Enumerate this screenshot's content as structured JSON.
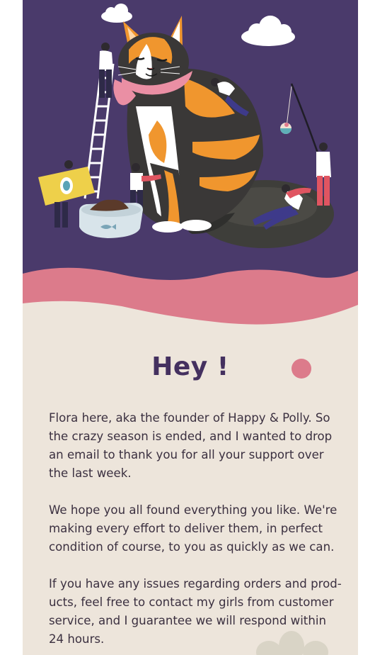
{
  "email": {
    "headline": "Hey !",
    "paragraphs": [
      "Flora here, aka the founder of Happy & Polly. So the crazy season is ended, and I wanted to drop an email to thank you for all your support over the last week.",
      "We hope you all found everything you like. We're making every effort to deliver them, in perfect condition of course, to you as quickly as we can.",
      "If you have any issues regarding orders and prod-ucts, feel free to contact my girls from customer service, and I guarantee we will respond within 24 hours."
    ]
  },
  "colors": {
    "hero_background": "#4a3a6b",
    "wave_pink": "#dc7b8b",
    "page_background": "#ede5db",
    "headline": "#44305f",
    "accent_dot": "#dc7b8b"
  },
  "illustration": {
    "subject": "giant calico cat with tiny people",
    "icons": [
      "cloud-icon",
      "ladder-icon",
      "cat-food-box-icon",
      "food-bowl-icon",
      "fishing-rod-icon",
      "cat-bed-icon"
    ]
  }
}
